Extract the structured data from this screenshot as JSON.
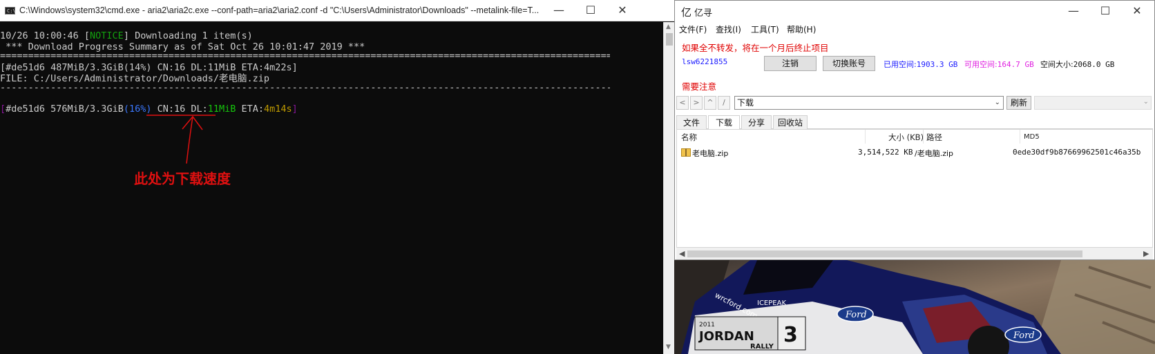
{
  "cmd": {
    "title": "C:\\Windows\\system32\\cmd.exe - aria2\\aria2c.exe  --conf-path=aria2\\aria2.conf -d \"C:\\Users\\Administrator\\Downloads\" --metalink-file=T...",
    "icon": "console-icon",
    "lines": {
      "l1_time": "10/26 10:00:46 [",
      "l1_notice": "NOTICE",
      "l1_rest": "] Downloading 1 item(s)",
      "l2": " *** Download Progress Summary as of Sat Oct 26 10:01:47 2019 ***",
      "sep1": "================================================================================================================",
      "l4": "[#de51d6 487MiB/3.3GiB(14%) CN:16 DL:11MiB ETA:4m22s]",
      "l5": "FILE: C:/Users/Administrator/Downloads/老电脑.zip",
      "sep2": "----------------------------------------------------------------------------------------------------------------",
      "p_open": "[",
      "p_gid": "#de51d6 576MiB/3.3GiB",
      "p_pct": "(16%)",
      "p_cn": " CN:16 DL:",
      "p_dl": "11MiB",
      "p_eta_label": " ETA:",
      "p_eta": "4m14s",
      "p_close": "]"
    },
    "annotation": "此处为下载速度",
    "colors": {
      "notice": "#13a10e",
      "percent": "#3b78ff",
      "speed": "#16c60c",
      "eta": "#c19c00",
      "bracket": "#881798",
      "annotation": "#e01010"
    }
  },
  "yixun": {
    "logo": "亿",
    "title": "亿寻",
    "menu": [
      "文件(F)",
      "查找(I)",
      "工具(T)",
      "帮助(H)"
    ],
    "notice": "如果全不转发，将在一个月后终止项目",
    "user": "lsw6221855",
    "logout": "注销",
    "switch": "切换账号",
    "used_label": "已用空间:",
    "used_value": "1903.3 GB",
    "free_label": "可用空间:",
    "free_value": "164.7 GB",
    "total_label": "空间大小:",
    "total_value": "2068.0 GB",
    "warn": "需要注意",
    "nav": [
      "<",
      ">",
      "^",
      "/"
    ],
    "path": "下载",
    "refresh": "刷新",
    "tabs": [
      "文件",
      "下载",
      "分享",
      "回收站"
    ],
    "columns": [
      "名称",
      "大小 (KB)",
      "路径",
      "MD5"
    ],
    "rows": [
      {
        "name": "老电脑.zip",
        "size": "3,514,522 KB",
        "path": "/老电脑.zip",
        "md5": "0ede30df9b87669962501c46a35b"
      }
    ]
  },
  "desktop": {
    "text_site": "wrcford.com",
    "text_jordan": "JORDAN",
    "text_rally": "RALLY",
    "text_2011": "2011",
    "text_number": "3",
    "text_ford1": "Ford",
    "text_ford2": "Ford",
    "text_icepeak": "ICEPEAK"
  }
}
